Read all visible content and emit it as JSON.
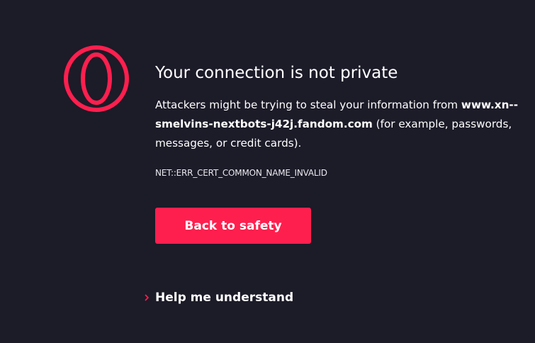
{
  "page": {
    "title": "Your connection is not private",
    "description_prefix": "Attackers might be trying to steal your information from ",
    "domain": "www.xn--smelvins-nextbots-j42j.fandom.com",
    "description_suffix": " (for example, passwords, messages, or credit cards).",
    "error_code": "NET::ERR_CERT_COMMON_NAME_INVALID",
    "back_button_label": "Back to safety",
    "help_label": "Help me understand"
  },
  "icons": {
    "logo": "opera-logo-icon",
    "help_chevron": "chevron-right-icon"
  },
  "colors": {
    "background": "#1c1b28",
    "accent": "#ff1f4e",
    "text": "#ffffff"
  }
}
